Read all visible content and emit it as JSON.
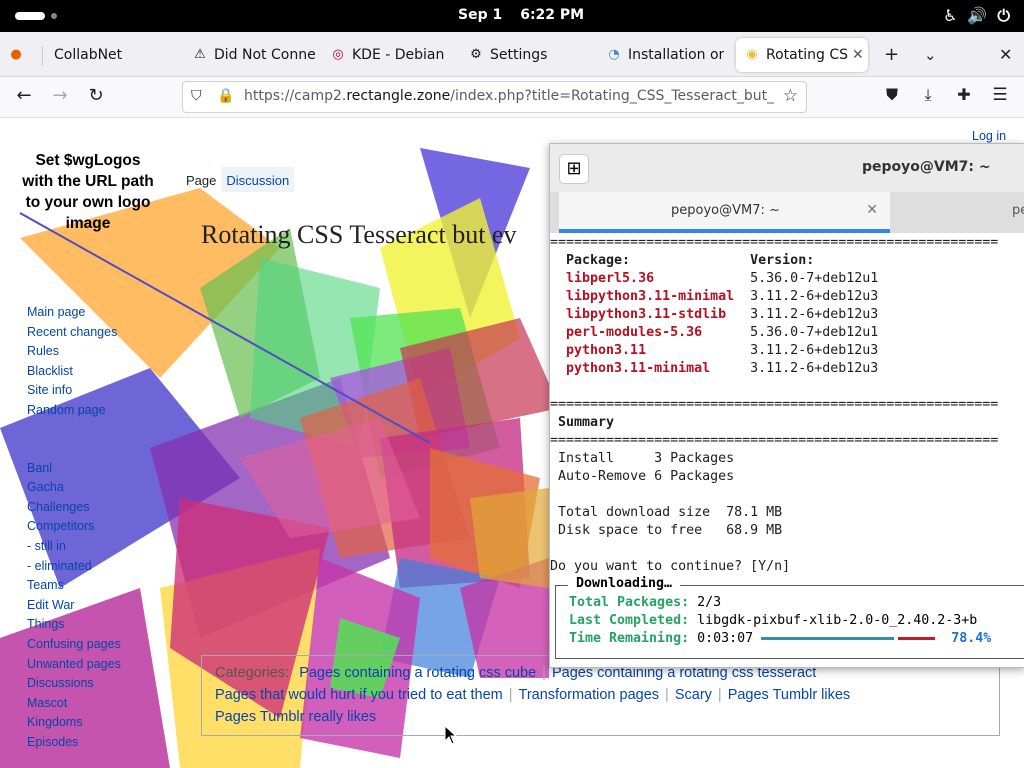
{
  "topbar": {
    "date": "Sep 1",
    "time": "6:22 PM"
  },
  "browser": {
    "tabs": [
      {
        "label": "CollabNet",
        "icon": "firefox-icon"
      },
      {
        "label": "Did Not Conne",
        "icon": "warning-icon"
      },
      {
        "label": "KDE - Debian",
        "icon": "debian-icon"
      },
      {
        "label": "Settings",
        "icon": "gear-icon"
      },
      {
        "label": "Installation on",
        "icon": "site-icon"
      },
      {
        "label": "Rotating CS",
        "icon": "site-icon"
      }
    ],
    "url_prefix": "https://camp2.",
    "url_domain": "rectangle.zone",
    "url_path": "/index.php?title=Rotating_CSS_Tesseract_but_e"
  },
  "wiki": {
    "logo_text": "Set $wgLogos with the URL path to your own logo image",
    "login": "Log in",
    "tab_page": "Page",
    "tab_discussion": "Discussion",
    "title": "Rotating CSS Tesseract but ev",
    "nav": [
      "Main page",
      "Recent changes",
      "Rules",
      "Blacklist",
      "Site info",
      "Random page"
    ],
    "nav2": [
      "Banl",
      "Gacha",
      "Challenges",
      "Competitors",
      "- still in",
      "- eliminated",
      "Teams",
      "Edit War",
      "Things",
      "Confusing pages",
      "Unwanted pages",
      "Discussions",
      "Mascot",
      "Kingdoms",
      "Episodes"
    ],
    "categories_label": "Categories:",
    "categories": [
      "Pages containing a rotating css cube",
      "Pages containing a rotating css tesseract",
      "Pages that would hurt if you tried to eat them",
      "Transformation pages",
      "Scary",
      "Pages Tumblr likes",
      "Pages Tumblr really likes"
    ]
  },
  "terminal": {
    "title": "pepoyo@VM7: ~",
    "tab1": "pepoyo@VM7: ~",
    "tab2": "pe",
    "rule": "========================================================",
    "col_package": "Package:",
    "col_version": "Version:",
    "packages": [
      {
        "name": "libperl5.36",
        "version": "5.36.0-7+deb12u1"
      },
      {
        "name": "libpython3.11-minimal",
        "version": "3.11.2-6+deb12u3"
      },
      {
        "name": "libpython3.11-stdlib",
        "version": "3.11.2-6+deb12u3"
      },
      {
        "name": "perl-modules-5.36",
        "version": "5.36.0-7+deb12u1"
      },
      {
        "name": "python3.11",
        "version": "3.11.2-6+deb12u3"
      },
      {
        "name": "python3.11-minimal",
        "version": "3.11.2-6+deb12u3"
      }
    ],
    "summary": "Summary",
    "install": "Install     3 Packages",
    "autoremove": "Auto-Remove 6 Packages",
    "download_size": "Total download size  78.1 MB",
    "disk_space": "Disk space to free   68.9 MB",
    "prompt": "Do you want to continue? [Y/n]",
    "download": {
      "legend": "Downloading…",
      "total_label": "Total Packages:",
      "total_value": "2/3",
      "last_label": "Last Completed:",
      "last_value": "libgdk-pixbuf-xlib-2.0-0_2.40.2-3+b",
      "time_label": "Time Remaining:",
      "time_value": "0:03:07",
      "percent_text": "78.4%",
      "progress": 0.784
    }
  },
  "colors": {
    "link": "#0645ad",
    "package": "#b5111f",
    "accent": "#3584e4",
    "label_green": "#26a269",
    "percent_blue": "#1c71d8"
  }
}
